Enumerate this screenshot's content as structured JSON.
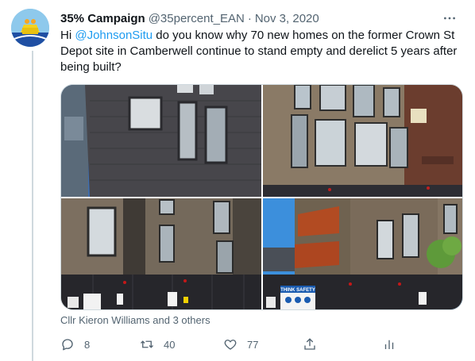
{
  "tweet": {
    "display_name": "35% Campaign",
    "handle": "@35percent_EAN",
    "separator": "·",
    "date": "Nov 3, 2020",
    "text_before": "Hi ",
    "mention": "@JohnsonSitu",
    "text_after": " do you know why 70 new homes on the former Crown St Depot site in Camberwell continue to stand empty and derelict 5 years after being built?",
    "liked_by": "Cllr Kieron Williams and 3 others",
    "photo_signs": {
      "think_safety": "THINK SAFETY"
    }
  },
  "actions": {
    "reply_count": "8",
    "retweet_count": "40",
    "like_count": "77"
  },
  "colors": {
    "accent": "#1d9bf0",
    "muted": "#536471"
  },
  "icons": [
    "more-icon",
    "reply-icon",
    "retweet-icon",
    "like-icon",
    "share-icon",
    "analytics-icon"
  ]
}
